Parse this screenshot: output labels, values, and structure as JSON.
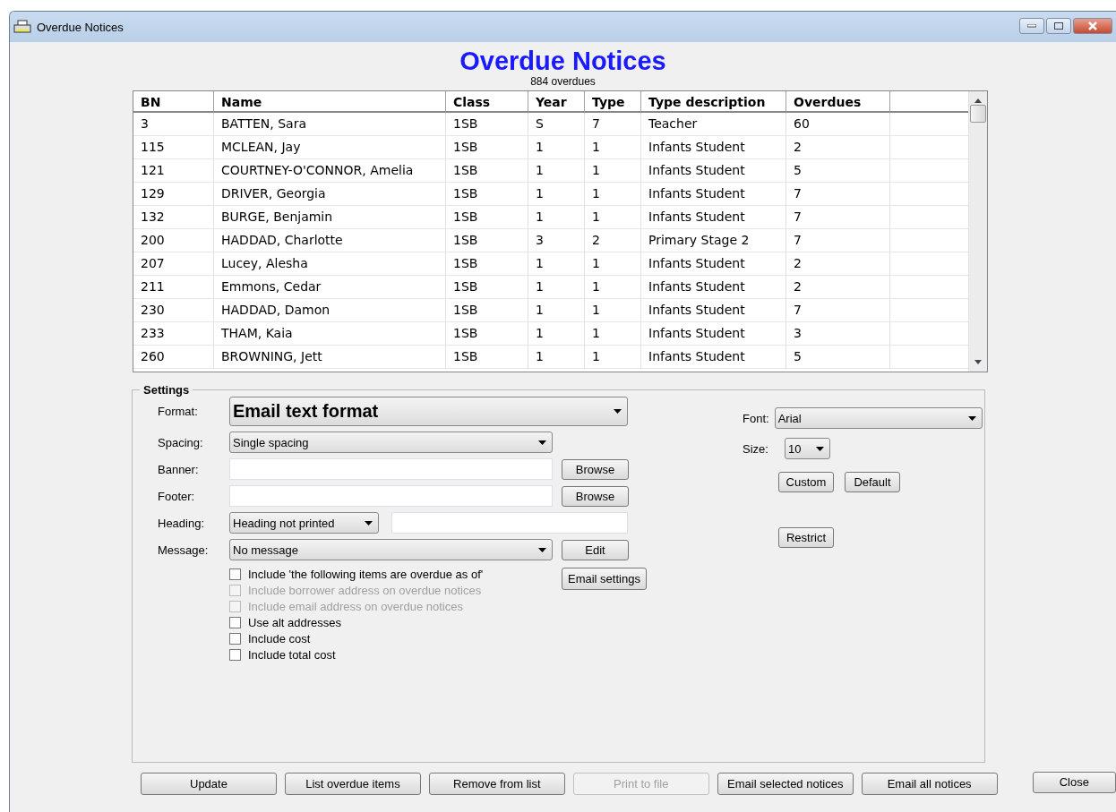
{
  "window": {
    "title": "Overdue Notices"
  },
  "header": {
    "title": "Overdue Notices",
    "subtitle": "884 overdues"
  },
  "table": {
    "columns": [
      "BN",
      "Name",
      "Class",
      "Year",
      "Type",
      "Type description",
      "Overdues"
    ],
    "rows": [
      [
        "3",
        "BATTEN, Sara",
        "1SB",
        "S",
        "7",
        "Teacher",
        "60"
      ],
      [
        "115",
        "MCLEAN, Jay",
        "1SB",
        "1",
        "1",
        "Infants Student",
        "2"
      ],
      [
        "121",
        "COURTNEY-O'CONNOR, Amelia",
        "1SB",
        "1",
        "1",
        "Infants Student",
        "5"
      ],
      [
        "129",
        "DRIVER, Georgia",
        "1SB",
        "1",
        "1",
        "Infants Student",
        "7"
      ],
      [
        "132",
        "BURGE, Benjamin",
        "1SB",
        "1",
        "1",
        "Infants Student",
        "7"
      ],
      [
        "200",
        "HADDAD, Charlotte",
        "1SB",
        "3",
        "2",
        "Primary Stage 2",
        "7"
      ],
      [
        "207",
        "Lucey, Alesha",
        "1SB",
        "1",
        "1",
        "Infants Student",
        "2"
      ],
      [
        "211",
        "Emmons, Cedar",
        "1SB",
        "1",
        "1",
        "Infants Student",
        "2"
      ],
      [
        "230",
        "HADDAD, Damon",
        "1SB",
        "1",
        "1",
        "Infants Student",
        "7"
      ],
      [
        "233",
        "THAM, Kaia",
        "1SB",
        "1",
        "1",
        "Infants Student",
        "3"
      ],
      [
        "260",
        "BROWNING, Jett",
        "1SB",
        "1",
        "1",
        "Infants Student",
        "5"
      ]
    ]
  },
  "settings": {
    "legend": "Settings",
    "format": {
      "label": "Format:",
      "value": "Email text format"
    },
    "spacing": {
      "label": "Spacing:",
      "value": "Single spacing"
    },
    "banner": {
      "label": "Banner:",
      "button": "Browse"
    },
    "footer": {
      "label": "Footer:",
      "button": "Browse"
    },
    "heading": {
      "label": "Heading:",
      "value": "Heading not printed"
    },
    "message": {
      "label": "Message:",
      "value": "No message",
      "button": "Edit"
    },
    "email_settings": "Email settings",
    "checkboxes": [
      {
        "label": "Include 'the following items are overdue as of'",
        "checked": false,
        "disabled": false
      },
      {
        "label": "Include borrower address on overdue notices",
        "checked": false,
        "disabled": true
      },
      {
        "label": "Include email address on overdue notices",
        "checked": false,
        "disabled": true
      },
      {
        "label": "Use alt addresses",
        "checked": false,
        "disabled": false
      },
      {
        "label": "Include cost",
        "checked": false,
        "disabled": false
      },
      {
        "label": "Include total cost",
        "checked": false,
        "disabled": false
      }
    ],
    "font": {
      "label": "Font:",
      "value": "Arial"
    },
    "size": {
      "label": "Size:",
      "value": "10"
    },
    "custom": "Custom",
    "default": "Default",
    "restrict": "Restrict"
  },
  "buttons": [
    {
      "label": "Update",
      "disabled": false
    },
    {
      "label": "List overdue items",
      "disabled": false
    },
    {
      "label": "Remove from list",
      "disabled": false
    },
    {
      "label": "Print to file",
      "disabled": true
    },
    {
      "label": "Email selected notices",
      "disabled": false
    },
    {
      "label": "Email all notices",
      "disabled": false
    }
  ],
  "close": "Close"
}
